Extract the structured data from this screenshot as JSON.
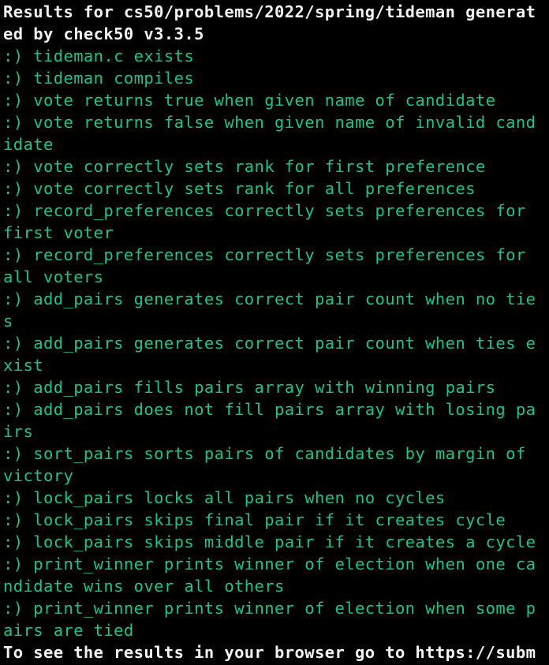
{
  "terminal": {
    "header_lines": [
      "Results for cs50/problems/2022/spring/tideman generat",
      "ed by check50 v3.3.5"
    ],
    "result_lines": [
      ":) tideman.c exists",
      ":) tideman compiles",
      ":) vote returns true when given name of candidate",
      ":) vote returns false when given name of invalid cand",
      "idate",
      ":) vote correctly sets rank for first preference",
      ":) vote correctly sets rank for all preferences",
      ":) record_preferences correctly sets preferences for",
      "first voter",
      ":) record_preferences correctly sets preferences for",
      "all voters",
      ":) add_pairs generates correct pair count when no tie",
      "s",
      ":) add_pairs generates correct pair count when ties e",
      "xist",
      ":) add_pairs fills pairs array with winning pairs",
      ":) add_pairs does not fill pairs array with losing pa",
      "irs",
      ":) sort_pairs sorts pairs of candidates by margin of",
      "victory",
      ":) lock_pairs locks all pairs when no cycles",
      ":) lock_pairs skips final pair if it creates cycle",
      ":) lock_pairs skips middle pair if it creates a cycle",
      ":) print_winner prints winner of election when one ca",
      "ndidate wins over all others",
      ":) print_winner prints winner of election when some p",
      "airs are tied"
    ],
    "footer_line": "To see the results in your browser go to https://subm",
    "colors": {
      "background": "#000000",
      "header_text": "#f2f2f2",
      "pass_text": "#1fc28a"
    }
  }
}
